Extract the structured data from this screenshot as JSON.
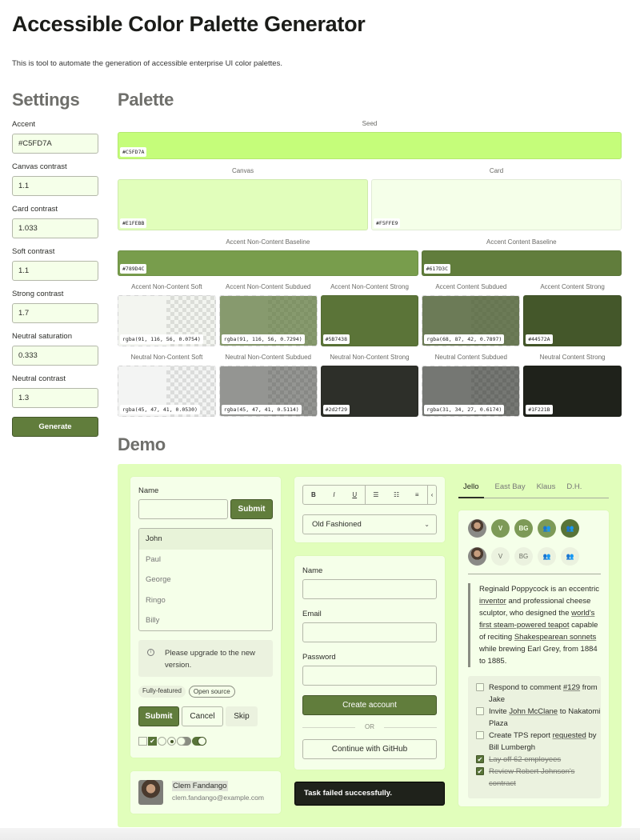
{
  "header": {
    "title": "Accessible Color Palette Generator",
    "intro": "This is tool to automate the generation of accessible enterprise UI color palettes."
  },
  "settings": {
    "title": "Settings",
    "fields": [
      {
        "label": "Accent",
        "value": "#C5FD7A"
      },
      {
        "label": "Canvas contrast",
        "value": "1.1"
      },
      {
        "label": "Card contrast",
        "value": "1.033"
      },
      {
        "label": "Soft contrast",
        "value": "1.1"
      },
      {
        "label": "Strong contrast",
        "value": "1.7"
      },
      {
        "label": "Neutral saturation",
        "value": "0.333"
      },
      {
        "label": "Neutral contrast",
        "value": "1.3"
      }
    ],
    "generate_label": "Generate"
  },
  "palette": {
    "title": "Palette",
    "seed": {
      "label": "Seed",
      "value": "#C5FD7A",
      "color": "#C5FD7A"
    },
    "canvas": {
      "label": "Canvas",
      "value": "#E1FEBB",
      "color": "#E1FEBB"
    },
    "card": {
      "label": "Card",
      "value": "#F5FFE9",
      "color": "#F5FFE9"
    },
    "accent_noncontent_baseline": {
      "label": "Accent Non-Content Baseline",
      "value": "#789D4C",
      "color": "#789D4C"
    },
    "accent_content_baseline": {
      "label": "Accent Content Baseline",
      "value": "#617D3C",
      "color": "#617D3C"
    },
    "accent_row": [
      {
        "label": "Accent Non-Content Soft",
        "value": "rgba(91, 116, 56, 0.0754)",
        "color": "rgba(91,116,56,0.0754)",
        "transparent": true
      },
      {
        "label": "Accent Non-Content Subdued",
        "value": "rgba(91, 116, 56, 0.7294)",
        "color": "rgba(91,116,56,0.7294)",
        "transparent": true
      },
      {
        "label": "Accent Non-Content Strong",
        "value": "#5B7438",
        "color": "#5B7438",
        "transparent": false
      },
      {
        "label": "Accent Content Subdued",
        "value": "rgba(68, 87, 42, 0.7897)",
        "color": "rgba(68,87,42,0.7897)",
        "transparent": true
      },
      {
        "label": "Accent Content Strong",
        "value": "#44572A",
        "color": "#44572A",
        "transparent": false
      }
    ],
    "neutral_row": [
      {
        "label": "Neutral Non-Content Soft",
        "value": "rgba(45, 47, 41, 0.0530)",
        "color": "rgba(45,47,41,0.0530)",
        "transparent": true
      },
      {
        "label": "Neutral Non-Content Subdued",
        "value": "rgba(45, 47, 41, 0.5114)",
        "color": "rgba(45,47,41,0.5114)",
        "transparent": true
      },
      {
        "label": "Neutral Non-Content Strong",
        "value": "#2d2f29",
        "color": "#2d2f29",
        "transparent": false
      },
      {
        "label": "Neutral Content Subdued",
        "value": "rgba(31, 34, 27, 0.6174)",
        "color": "rgba(31,34,27,0.6174)",
        "transparent": true
      },
      {
        "label": "Neutral Content Strong",
        "value": "#1F221B",
        "color": "#1F221B",
        "transparent": false
      }
    ]
  },
  "demo": {
    "title": "Demo",
    "card1": {
      "name_label": "Name",
      "submit_label": "Submit",
      "list_options": [
        "John",
        "Paul",
        "George",
        "Ringo",
        "Billy"
      ],
      "selected_option": "John",
      "alert_text": "Please upgrade to the new version.",
      "tags": [
        "Fully-featured",
        "Open source"
      ],
      "buttons": [
        "Submit",
        "Cancel",
        "Skip"
      ]
    },
    "profile": {
      "name": "Clem Fandango",
      "email": "clem.fandango@example.com"
    },
    "editor": {
      "toolbar": [
        "B",
        "I",
        "U"
      ],
      "select_value": "Old Fashioned"
    },
    "signup": {
      "name_label": "Name",
      "email_label": "Email",
      "password_label": "Password",
      "create_label": "Create account",
      "or_label": "OR",
      "github_label": "Continue with GitHub"
    },
    "toast": "Task failed successfully.",
    "tabs": [
      "Jello",
      "East Bay",
      "Klaus",
      "D.H."
    ],
    "active_tab": "Jello",
    "avatars": [
      "V",
      "BG"
    ],
    "quote": {
      "parts": [
        {
          "text": "Reginald Poppycock is an eccentric ",
          "link": false
        },
        {
          "text": "inventor",
          "link": true
        },
        {
          "text": " and professional cheese sculptor, who designed the ",
          "link": false
        },
        {
          "text": "world's first steam-powered teapot",
          "link": true
        },
        {
          "text": " capable of reciting ",
          "link": false
        },
        {
          "text": "Shakespearean sonnets",
          "link": true
        },
        {
          "text": " while brewing Earl Grey, from 1884 to 1885.",
          "link": false
        }
      ]
    },
    "todos": [
      {
        "pre": "Respond to comment ",
        "link": "#129",
        "post": " from Jake",
        "done": false
      },
      {
        "pre": "Invite ",
        "link": "John McClane",
        "post": " to Nakatomi Plaza",
        "done": false
      },
      {
        "pre": "Create TPS report ",
        "link": "requested",
        "post": " by Bill Lumbergh",
        "done": false
      },
      {
        "pre": "Lay off 62 employees",
        "link": "",
        "post": "",
        "done": true
      },
      {
        "pre": "Review Robert Johnson's contract",
        "link": "",
        "post": "",
        "done": true
      }
    ]
  }
}
